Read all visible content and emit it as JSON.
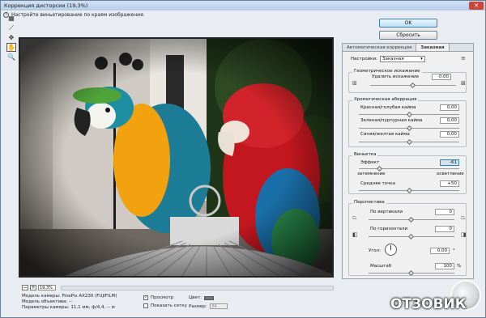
{
  "window": {
    "title": "Коррекция дисторсии (19,3%)",
    "close_glyph": "✕"
  },
  "tip": {
    "icon": "info-icon",
    "text": "Настройте виньетирование по краям изображения."
  },
  "tools": [
    "distortion-tool",
    "straighten-tool",
    "move-grid-tool",
    "hand-tool",
    "zoom-tool"
  ],
  "buttons": {
    "ok": "OK",
    "reset": "Сбросить"
  },
  "canvas_ctrl": {
    "zoom_out": "−",
    "zoom_in": "+",
    "zoom": "19,3%"
  },
  "metadata": {
    "camera": "Модель камеры: FinePix AX230 (FUJIFILM)",
    "lens": "Модель объектива: --",
    "params": "Параметры камеры: 11,1 мм, ф/4,4, -- м"
  },
  "view": {
    "preview_label": "Просмотр",
    "preview_checked": true,
    "grid_label": "Показать сетку",
    "grid_checked": false,
    "color_label": "Цвет:",
    "size_label": "Размер:",
    "size_value": "64"
  },
  "panel": {
    "tabs": [
      "Автоматическая коррекция",
      "Заказная"
    ],
    "settings_label": "Настройки:",
    "settings_value": "Заказная",
    "geometry": {
      "title": "Геометрическое искажение",
      "label": "Удалить искажение",
      "value": "0,00"
    },
    "chroma": {
      "title": "Хроматическая аберрация",
      "red": {
        "label": "Красная/голубая кайма",
        "value": "0,00"
      },
      "green": {
        "label": "Зеленая/пурпурная кайма",
        "value": "0,00"
      },
      "blue": {
        "label": "Синяя/желтая кайма",
        "value": "0,00"
      }
    },
    "vignette": {
      "title": "Виньетка",
      "effect_label": "Эффект",
      "effect_value": "-61",
      "darken_label": "затемнение",
      "lighten_label": "осветление",
      "mid_label": "Средняя точка",
      "mid_value": "+50"
    },
    "perspective": {
      "title": "Перспектива",
      "vertical_label": "По вертикали",
      "vertical_value": "0",
      "horizontal_label": "По горизонтали",
      "horizontal_value": "0",
      "angle_label": "Угол:",
      "angle_value": "0,00",
      "angle_unit": "°",
      "scale_label": "Масштаб",
      "scale_value": "100",
      "scale_unit": "%"
    }
  },
  "watermark": {
    "text": "ОТЗОВИК"
  }
}
